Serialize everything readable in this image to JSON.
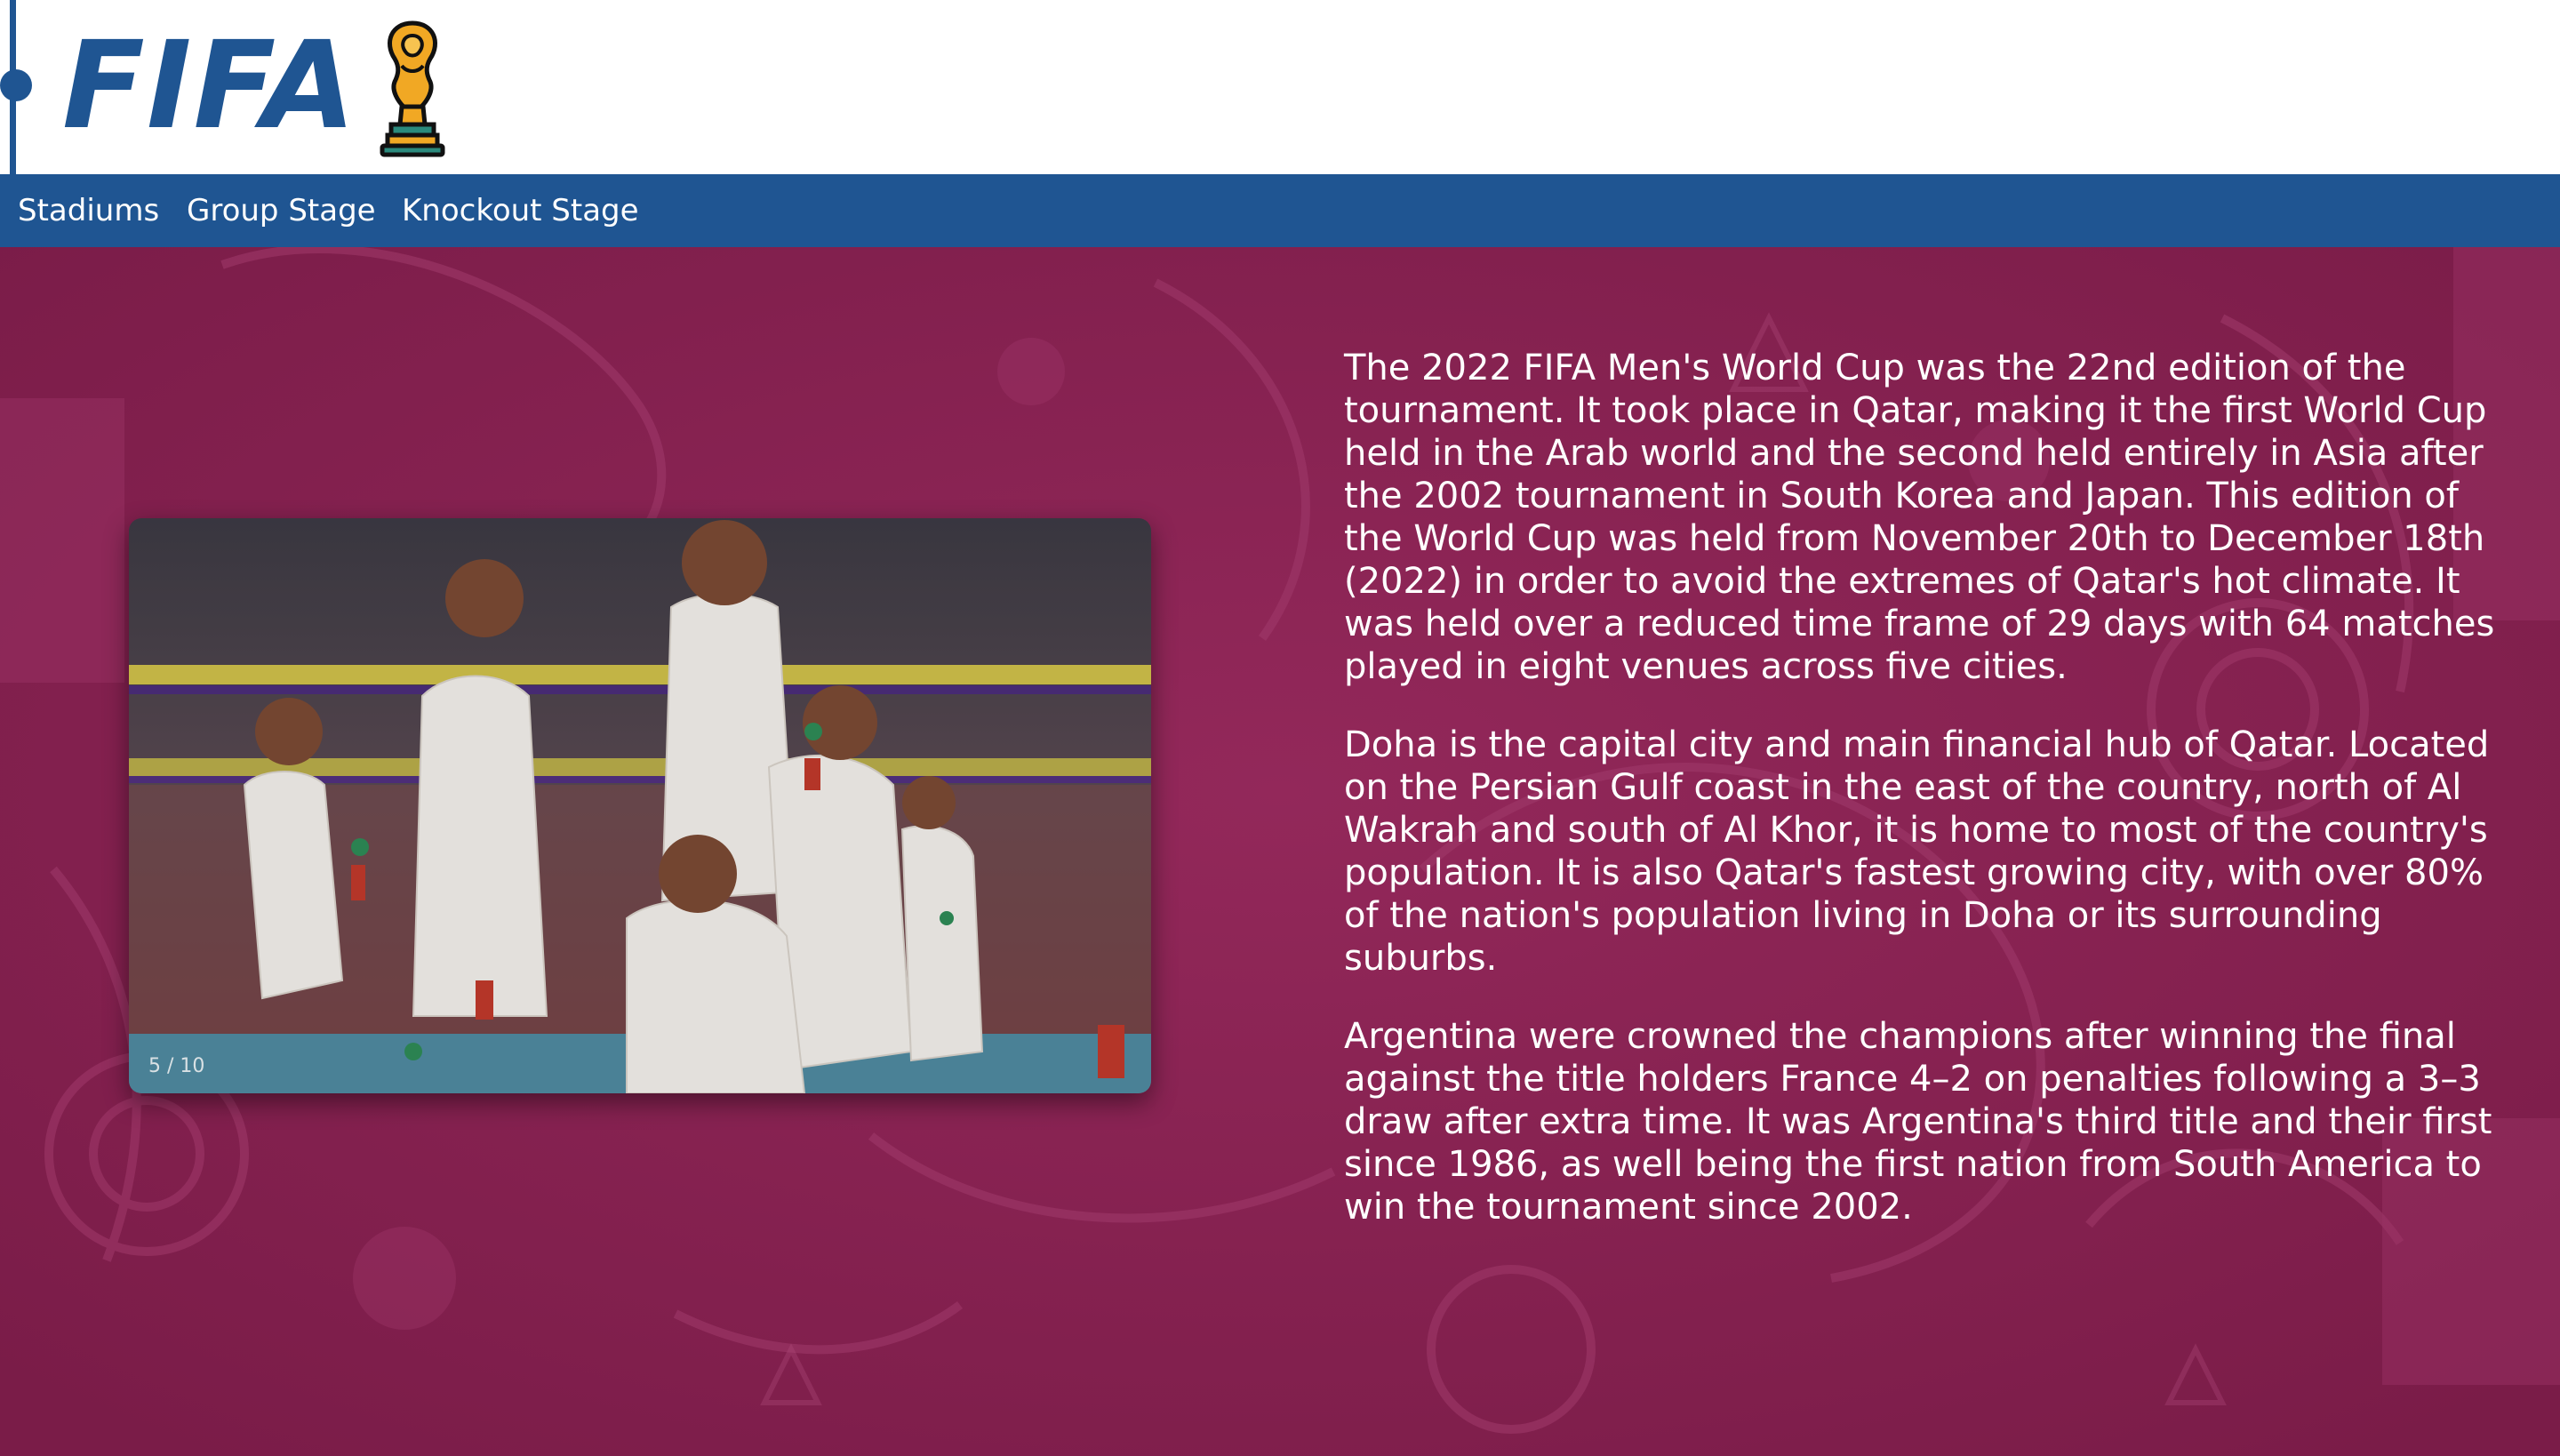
{
  "header": {
    "logo_text": "FIFA",
    "trophy_icon": "world-cup-trophy-icon"
  },
  "nav": {
    "items": [
      {
        "label": "Stadiums"
      },
      {
        "label": "Group Stage"
      },
      {
        "label": "Knockout Stage"
      }
    ]
  },
  "slideshow": {
    "counter": "5 / 10",
    "current_slide": 5,
    "total_slides": 10
  },
  "content": {
    "paragraphs": [
      "The 2022 FIFA Men's World Cup was the 22nd edition of the tournament. It took place in Qatar, making it the first World Cup held in the Arab world and the second held entirely in Asia after the 2002 tournament in South Korea and Japan. This edition of the World Cup was held from November 20th to December 18th (2022) in order to avoid the extremes of Qatar's hot climate. It was held over a reduced time frame of 29 days with 64 matches played in eight venues across five cities.",
      "Doha is the capital city and main financial hub of Qatar. Located on the Persian Gulf coast in the east of the country, north of Al Wakrah and south of Al Khor, it is home to most of the country's population. It is also Qatar's fastest growing city, with over 80% of the nation's population living in Doha or its surrounding suburbs.",
      "Argentina were crowned the champions after winning the final against the title holders France 4–2 on penalties following a 3–3 draw after extra time. It was Argentina's third title and their first since 1986, as well being the first nation from South America to win the tournament since 2002."
    ]
  },
  "colors": {
    "brand_blue": "#1f5592",
    "background_maroon": "#8a2252",
    "trophy_gold": "#f1a824",
    "text_white": "#ffffff"
  }
}
